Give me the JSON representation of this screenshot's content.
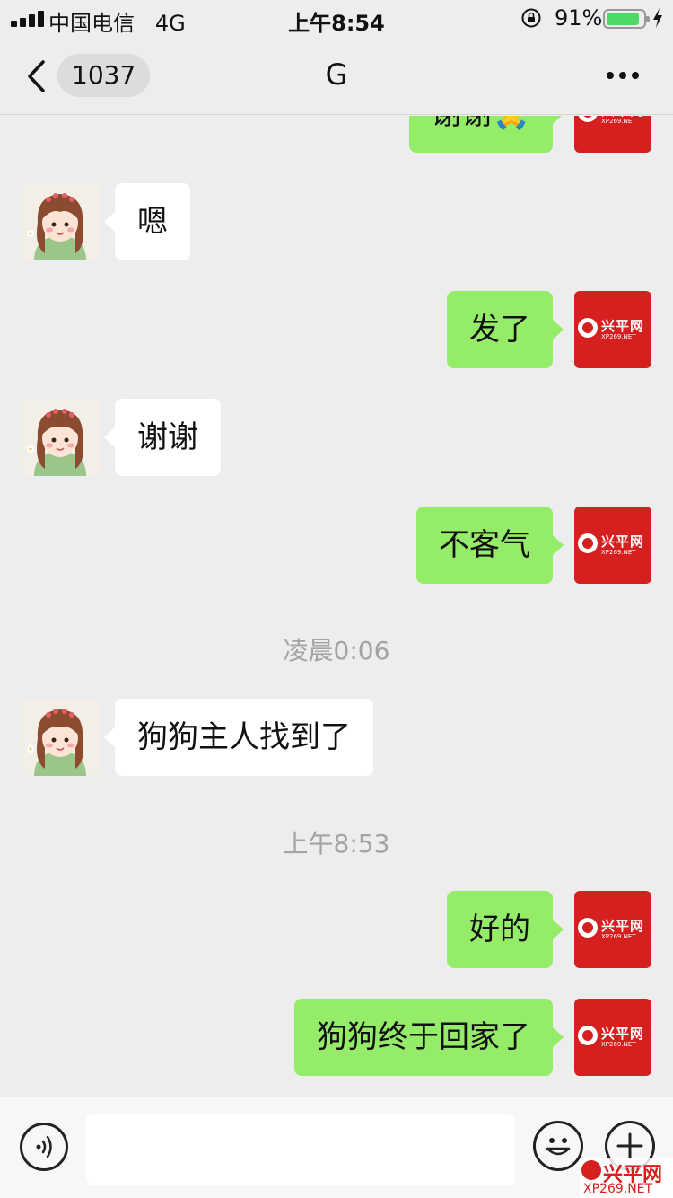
{
  "status_bar": {
    "carrier": "中国电信",
    "network": "4G",
    "time": "上午8:54",
    "battery_percent_label": "91%",
    "battery_level": 0.91,
    "battery_color": "#4cd964"
  },
  "nav": {
    "unread_count": "1037",
    "title": "G",
    "back_icon": "chevron-left-icon",
    "more_icon": "ellipsis-icon"
  },
  "messages": [
    {
      "direction": "out",
      "text": "谢谢🙏",
      "partially_visible": true
    },
    {
      "direction": "in",
      "text": "嗯"
    },
    {
      "direction": "out",
      "text": "发了"
    },
    {
      "direction": "in",
      "text": "谢谢"
    },
    {
      "direction": "out",
      "text": "不客气"
    },
    {
      "type": "timestamp",
      "text": "凌晨0:06"
    },
    {
      "direction": "in",
      "text": "狗狗主人找到了"
    },
    {
      "type": "timestamp",
      "text": "上午8:53"
    },
    {
      "direction": "out",
      "text": "好的"
    },
    {
      "direction": "out",
      "text": "狗狗终于回家了"
    }
  ],
  "avatars": {
    "contact_avatar": "cartoon-girl-avatar",
    "self_avatar_logo_text": "兴平网",
    "self_avatar_logo_sub": "XP269.NET"
  },
  "input_bar": {
    "voice_icon": "voice-icon",
    "emoji_icon": "emoji-icon",
    "plus_icon": "plus-icon",
    "placeholder": ""
  },
  "watermark": {
    "text": "兴平网",
    "sub": "XP269.NET"
  },
  "colors": {
    "background": "#ededed",
    "outgoing_bubble": "#95ec69",
    "incoming_bubble": "#ffffff",
    "logo_red": "#d62020"
  }
}
